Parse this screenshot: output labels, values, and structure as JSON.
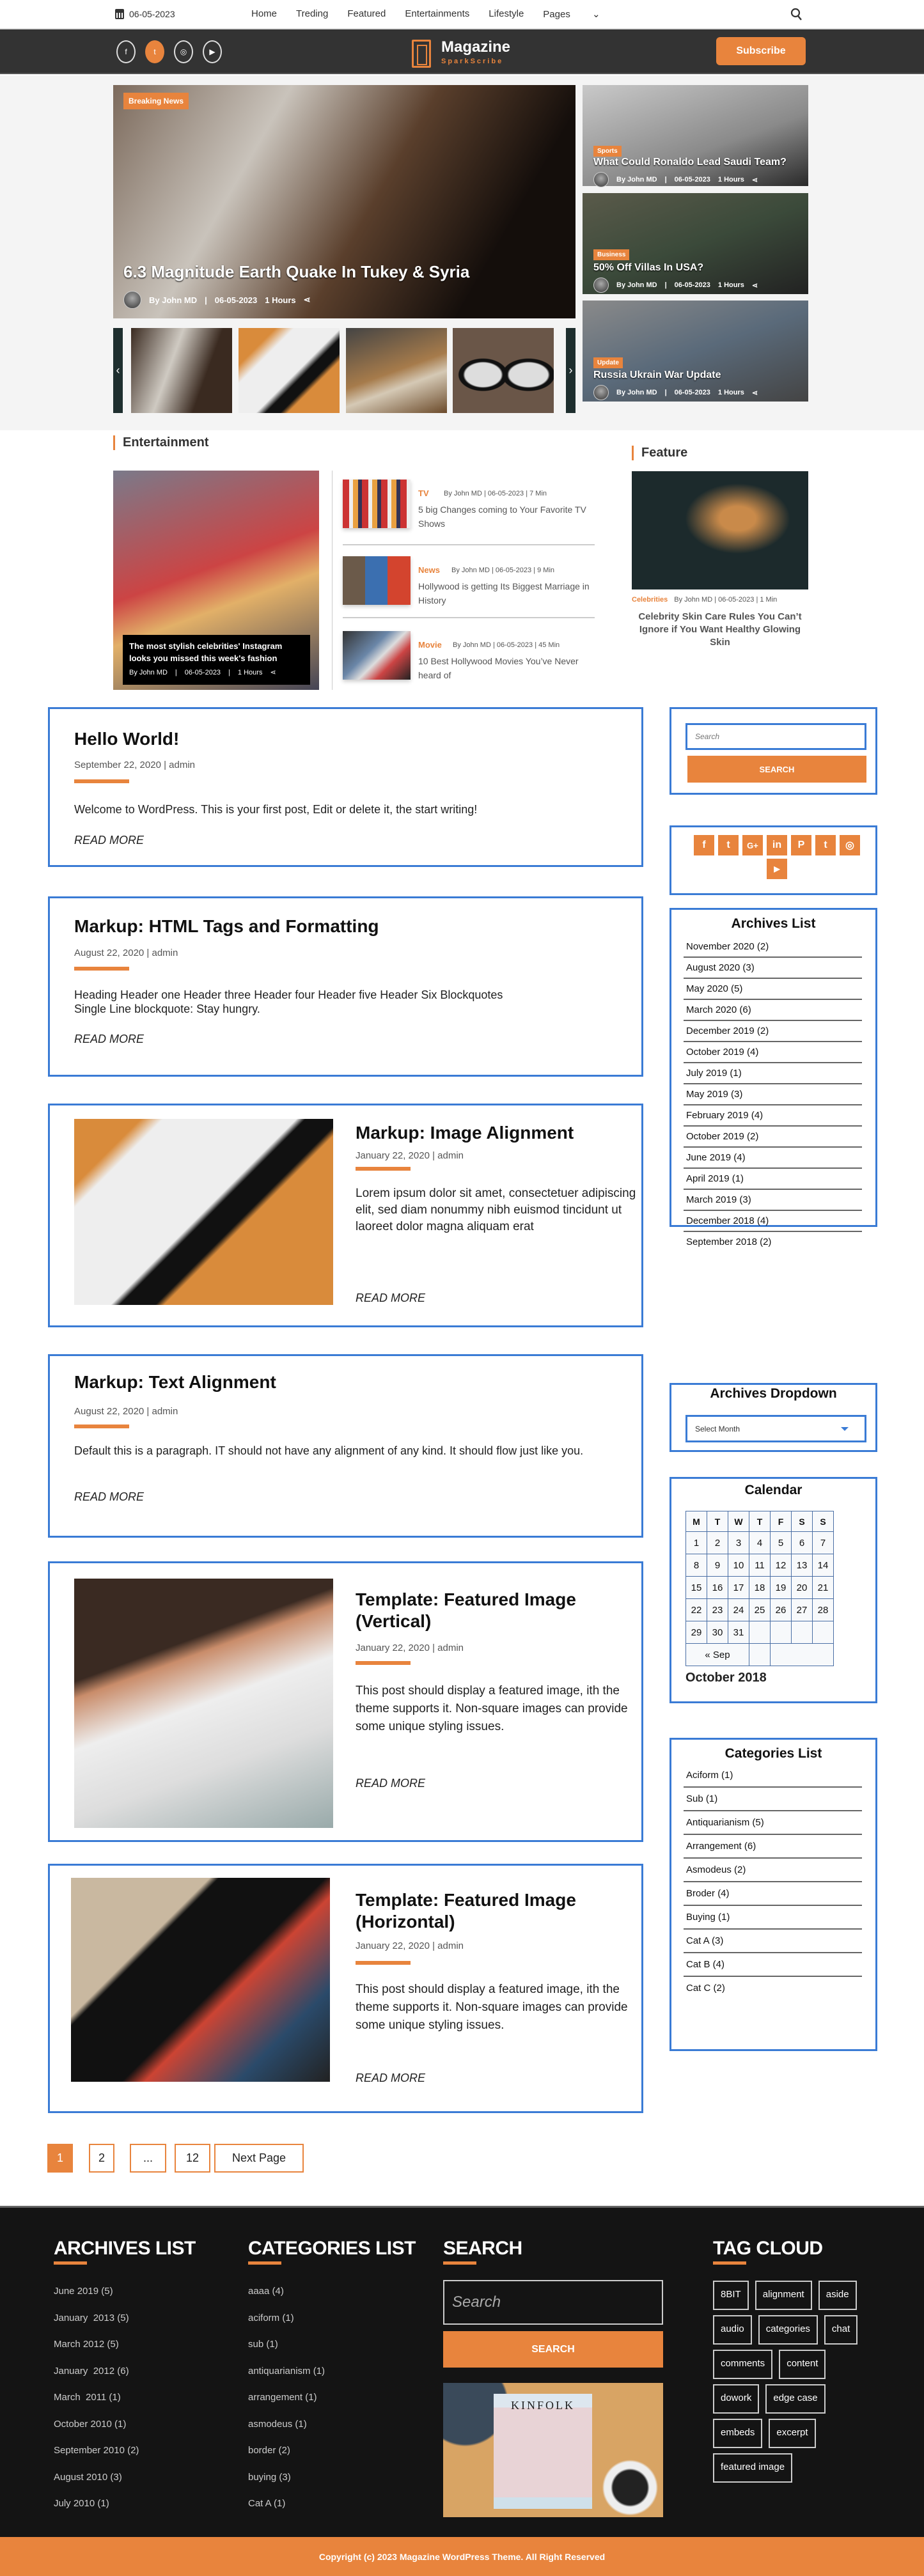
{
  "topbar": {
    "date": "06-05-2023",
    "nav": [
      "Home",
      "Treding",
      "Featured",
      "Entertainments",
      "Lifestyle",
      "Pages"
    ],
    "pages_caret": "⌄"
  },
  "brand": {
    "title": "Magazine",
    "subtitle": "SparkScribe",
    "subscribe_label": "Subscribe",
    "social": [
      "f",
      "t",
      "◎",
      "▶"
    ]
  },
  "hero": {
    "badge": "Breaking News",
    "title": "6.3 Magnitude Earth Quake In Tukey & Syria",
    "author": "By John MD",
    "date": "06-05-2023",
    "duration": "1 Hours",
    "prev": "‹",
    "next": "›"
  },
  "side_cards": [
    {
      "badge": "Sports",
      "title": "What Could Ronaldo Lead Saudi Team?",
      "author": "By John MD",
      "date": "06-05-2023",
      "duration": "1 Hours"
    },
    {
      "badge": "Business",
      "title": "50% Off Villas In USA?",
      "author": "By John MD",
      "date": "06-05-2023",
      "duration": "1 Hours"
    },
    {
      "badge": "Update",
      "title": "Russia Ukrain War Update",
      "author": "By John MD",
      "date": "06-05-2023",
      "duration": "1 Hours"
    }
  ],
  "entertainment": {
    "heading": "Entertainment",
    "main_caption": "The most stylish celebrities' Instagram looks you missed this week's fashion",
    "main_meta": {
      "author": "By John MD",
      "date": "06-05-2023",
      "duration": "1 Hours"
    },
    "items": [
      {
        "cat": "TV",
        "meta": "By John MD | 06-05-2023 | 7 Min",
        "title": "5 big Changes coming to Your Favorite TV Shows"
      },
      {
        "cat": "News",
        "meta": "By John MD | 06-05-2023 | 9 Min",
        "title": "Hollywood is getting Its Biggest Marriage in History"
      },
      {
        "cat": "Movie",
        "meta": "By John MD | 06-05-2023 | 45 Min",
        "title": "10 Best Hollywood Movies You’ve Never heard of"
      }
    ]
  },
  "feature": {
    "heading": "Feature",
    "cat": "Celebrities",
    "meta": "By John MD | 06-05-2023 | 1 Min",
    "title": "Celebrity Skin Care Rules You Can’t Ignore if You Want Healthy Glowing Skin"
  },
  "posts": [
    {
      "title": "Hello World!",
      "meta": "September 22, 2020 | admin",
      "excerpt": "Welcome to WordPress. This is your first post, Edit or delete it, the start writing!",
      "read_more": "READ MORE"
    },
    {
      "title": "Markup: HTML Tags and Formatting",
      "meta": "August 22, 2020 | admin",
      "excerpt": "Heading Header one Header three Header four Header five Header Six Blockquotes Single Line blockquote: Stay hungry.",
      "read_more": "READ MORE"
    },
    {
      "title": "Markup: Image Alignment",
      "meta": "January 22, 2020 | admin",
      "excerpt": "Lorem ipsum dolor sit amet, consectetuer adipiscing elit, sed diam nonummy nibh euismod tincidunt ut laoreet dolor magna aliquam erat",
      "read_more": "READ MORE"
    },
    {
      "title": "Markup: Text Alignment",
      "meta": "August 22, 2020 | admin",
      "excerpt": "Default this is a paragraph. IT should not have any alignment of any kind. It should flow just like you.",
      "read_more": "READ MORE"
    },
    {
      "title": "Template: Featured Image (Vertical)",
      "meta": "January 22, 2020 | admin",
      "excerpt": "This post should display a featured image, ith the theme supports it. Non-square images can provide some unique styling issues.",
      "read_more": "READ MORE"
    },
    {
      "title": "Template: Featured Image (Horizontal)",
      "meta": "January 22, 2020 | admin",
      "excerpt": "This post should display a featured image, ith the theme supports it. Non-square images can provide some unique styling issues.",
      "read_more": "READ MORE"
    }
  ],
  "pagination": {
    "pages": [
      "1",
      "2",
      "...",
      "12"
    ],
    "current": "1",
    "next": "Next Page"
  },
  "sidebar": {
    "search_placeholder": "Search",
    "search_button": "SEARCH",
    "social": [
      "f",
      "t",
      "G+",
      "in",
      "P",
      "t",
      "◎",
      "▶"
    ],
    "archives_title": "Archives List",
    "archives": [
      "November 2020 (2)",
      "August 2020 (3)",
      "May 2020 (5)",
      "March 2020 (6)",
      "December 2019 (2)",
      "October 2019 (4)",
      "July 2019 (1)",
      "May 2019 (3)",
      "February 2019 (4)",
      "October 2019 (2)",
      "June 2019 (4)",
      "April 2019 (1)",
      "March 2019 (3)",
      "December 2018 (4)",
      "September 2018 (2)"
    ],
    "dropdown_title": "Archives Dropdown",
    "dropdown_value": "Select Month",
    "calendar_title": "Calendar",
    "calendar_days": [
      "M",
      "T",
      "W",
      "T",
      "F",
      "S",
      "S"
    ],
    "calendar_weeks": [
      [
        "1",
        "2",
        "3",
        "4",
        "5",
        "6",
        "7"
      ],
      [
        "8",
        "9",
        "10",
        "11",
        "12",
        "13",
        "14"
      ],
      [
        "15",
        "16",
        "17",
        "18",
        "19",
        "20",
        "21"
      ],
      [
        "22",
        "23",
        "24",
        "25",
        "26",
        "27",
        "28"
      ],
      [
        "29",
        "30",
        "31",
        "",
        "",
        "",
        ""
      ]
    ],
    "calendar_prev": "« Sep",
    "calendar_month": "October 2018",
    "categories_title": "Categories List",
    "categories": [
      "Aciform (1)",
      "Sub (1)",
      "Antiquarianism (5)",
      "Arrangement (6)",
      "Asmodeus (2)",
      "Broder (4)",
      "Buying (1)",
      "Cat A (3)",
      "Cat B (4)",
      "Cat C (2)"
    ]
  },
  "footer": {
    "archives_title": "ARCHIVES LIST",
    "archives": [
      "June 2019 (5)",
      "January  2013 (5)",
      "March 2012 (5)",
      "January  2012 (6)",
      "March  2011 (1)",
      "October 2010 (1)",
      "September 2010 (2)",
      "August 2010 (3)",
      "July 2010 (1)"
    ],
    "categories_title": "CATEGORIES LIST",
    "categories": [
      "aaaa (4)",
      "aciform (1)",
      "sub (1)",
      "antiquarianism (1)",
      "arrangement (1)",
      "asmodeus (1)",
      "border (2)",
      "buying (3)",
      "Cat A (1)"
    ],
    "search_title": "SEARCH",
    "search_placeholder": "Search",
    "search_button": "SEARCH",
    "image_text": "KINFOLK",
    "tags_title": "TAG CLOUD",
    "tags": [
      "8BIT",
      "alignment",
      "aside",
      "audio",
      "categories",
      "chat",
      "comments",
      "content",
      "dowork",
      "edge case",
      "embeds",
      "excerpt",
      "featured image"
    ],
    "copyright": "Copyright (c) 2023 Magazine WordPress Theme. All Right Reserved"
  },
  "colors": {
    "accent": "#e8843d",
    "border_blue": "#3a7bd5",
    "dark": "#333333",
    "footer_bg": "#141414"
  }
}
